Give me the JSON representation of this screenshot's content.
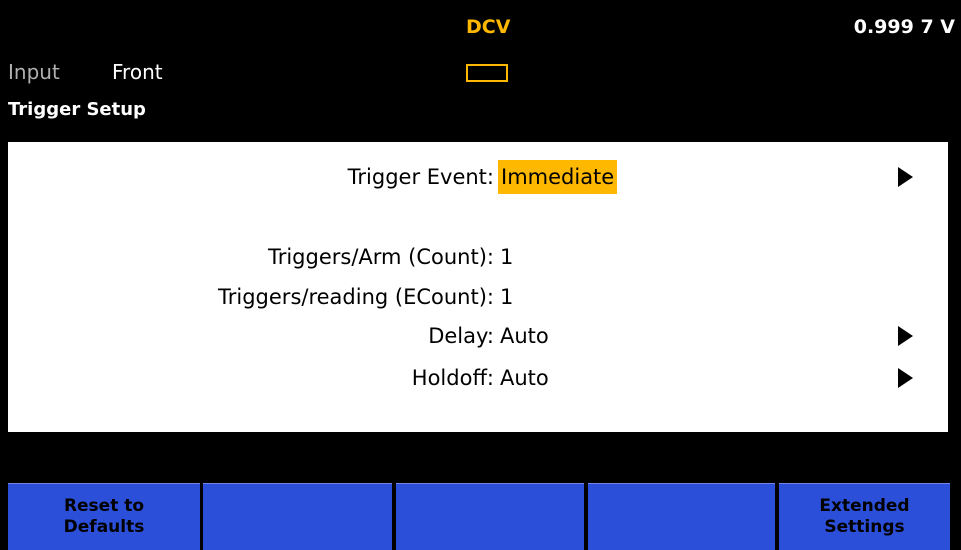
{
  "header": {
    "mode": "DCV",
    "reading": "0.999 7 V"
  },
  "status": {
    "input_label": "Input",
    "input_value": "Front",
    "screen_title": "Trigger Setup"
  },
  "settings": {
    "trigger_event": {
      "label": "Trigger Event:",
      "value": "Immediate"
    },
    "triggers_arm": {
      "label": "Triggers/Arm (Count):",
      "value": "1"
    },
    "triggers_reading": {
      "label": "Triggers/reading (ECount):",
      "value": "1"
    },
    "delay": {
      "label": "Delay:",
      "value": "Auto"
    },
    "holdoff": {
      "label": "Holdoff:",
      "value": "Auto"
    }
  },
  "softkeys": [
    {
      "label": "Reset to\nDefaults"
    },
    {
      "label": ""
    },
    {
      "label": ""
    },
    {
      "label": ""
    },
    {
      "label": "Extended\nSettings"
    }
  ],
  "colors": {
    "accent": "#ffb800",
    "softkey": "#2b4fd8",
    "background": "#000000",
    "panel": "#ffffff"
  },
  "icons": {
    "submenu": "right-triangle-arrow",
    "trigger_indicator": "outlined-rectangle"
  }
}
